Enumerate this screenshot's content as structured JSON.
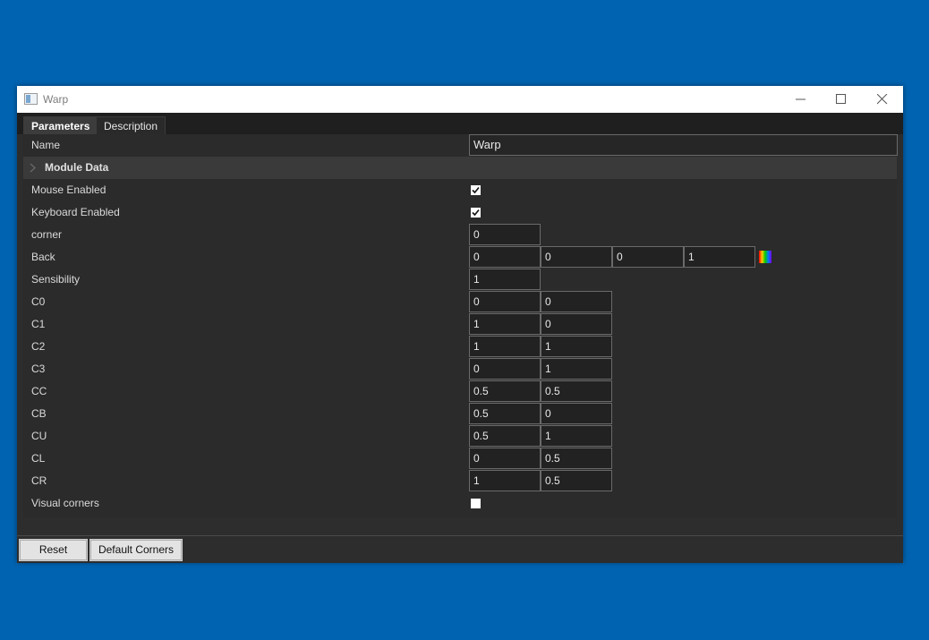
{
  "window": {
    "title": "Warp"
  },
  "tabs": [
    {
      "label": "Parameters",
      "active": true
    },
    {
      "label": "Description",
      "active": false
    }
  ],
  "params": {
    "name": {
      "label": "Name",
      "value": "Warp"
    },
    "module_data": {
      "label": "Module Data",
      "expanded": false
    },
    "mouse_enabled": {
      "label": "Mouse Enabled",
      "checked": true
    },
    "keyboard_enabled": {
      "label": "Keyboard Enabled",
      "checked": true
    },
    "corner": {
      "label": "corner",
      "values": [
        "0"
      ]
    },
    "back": {
      "label": "Back",
      "values": [
        "0",
        "0",
        "0",
        "1"
      ],
      "swatch_icon": "color-picker-icon"
    },
    "sensibility": {
      "label": "Sensibility",
      "values": [
        "1"
      ]
    },
    "c0": {
      "label": "C0",
      "values": [
        "0",
        "0"
      ]
    },
    "c1": {
      "label": "C1",
      "values": [
        "1",
        "0"
      ]
    },
    "c2": {
      "label": "C2",
      "values": [
        "1",
        "1"
      ]
    },
    "c3": {
      "label": "C3",
      "values": [
        "0",
        "1"
      ]
    },
    "cc": {
      "label": "CC",
      "values": [
        "0.5",
        "0.5"
      ]
    },
    "cb": {
      "label": "CB",
      "values": [
        "0.5",
        "0"
      ]
    },
    "cu": {
      "label": "CU",
      "values": [
        "0.5",
        "1"
      ]
    },
    "cl": {
      "label": "CL",
      "values": [
        "0",
        "0.5"
      ]
    },
    "cr": {
      "label": "CR",
      "values": [
        "1",
        "0.5"
      ]
    },
    "visual_corners": {
      "label": "Visual corners",
      "checked": false
    }
  },
  "footer": {
    "reset_label": "Reset",
    "default_corners_label": "Default Corners"
  },
  "colors": {
    "desktop": "#0063b1",
    "panel": "#2b2b2b",
    "field_border": "#6a6a6a"
  }
}
